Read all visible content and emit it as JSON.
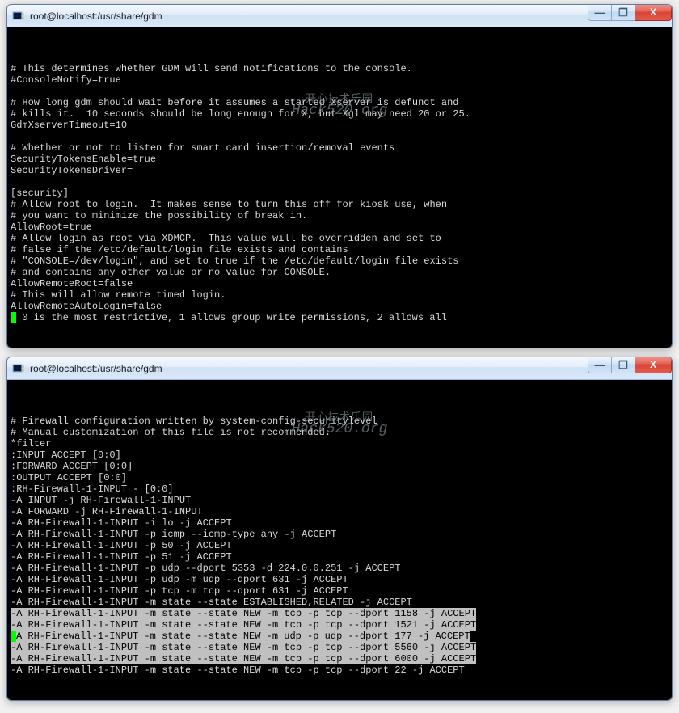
{
  "watermark": {
    "line1": "开心技术乐园",
    "line2": "Hack520.org"
  },
  "window1": {
    "title": "root@localhost:/usr/share/gdm",
    "controls": {
      "min": "—",
      "max": "❐",
      "close": "X"
    },
    "lines": [
      "# This determines whether GDM will send notifications to the console.",
      "#ConsoleNotify=true",
      "",
      "# How long gdm should wait before it assumes a started Xserver is defunct and",
      "# kills it.  10 seconds should be long enough for X, but Xgl may need 20 or 25.",
      "GdmXserverTimeout=10",
      "",
      "# Whether or not to listen for smart card insertion/removal events",
      "SecurityTokensEnable=true",
      "SecurityTokensDriver=",
      "",
      "[security]",
      "# Allow root to login.  It makes sense to turn this off for kiosk use, when",
      "# you want to minimize the possibility of break in.",
      "AllowRoot=true",
      "# Allow login as root via XDMCP.  This value will be overridden and set to",
      "# false if the /etc/default/login file exists and contains",
      "# \"CONSOLE=/dev/login\", and set to true if the /etc/default/login file exists",
      "# and contains any other value or no value for CONSOLE.",
      "AllowRemoteRoot=false",
      "# This will allow remote timed login.",
      "AllowRemoteAutoLogin=false",
      " 0 is the most restrictive, 1 allows group write permissions, 2 allows all"
    ],
    "prefix_last": "#"
  },
  "window2": {
    "title": "root@localhost:/usr/share/gdm",
    "controls": {
      "min": "—",
      "max": "❐",
      "close": "X"
    },
    "lines": [
      "# Firewall configuration written by system-config-securitylevel",
      "# Manual customization of this file is not recommended.",
      "*filter",
      ":INPUT ACCEPT [0:0]",
      ":FORWARD ACCEPT [0:0]",
      ":OUTPUT ACCEPT [0:0]",
      ":RH-Firewall-1-INPUT - [0:0]",
      "-A INPUT -j RH-Firewall-1-INPUT",
      "-A FORWARD -j RH-Firewall-1-INPUT",
      "-A RH-Firewall-1-INPUT -i lo -j ACCEPT",
      "-A RH-Firewall-1-INPUT -p icmp --icmp-type any -j ACCEPT",
      "-A RH-Firewall-1-INPUT -p 50 -j ACCEPT",
      "-A RH-Firewall-1-INPUT -p 51 -j ACCEPT",
      "-A RH-Firewall-1-INPUT -p udp --dport 5353 -d 224.0.0.251 -j ACCEPT",
      "-A RH-Firewall-1-INPUT -p udp -m udp --dport 631 -j ACCEPT",
      "-A RH-Firewall-1-INPUT -p tcp -m tcp --dport 631 -j ACCEPT",
      "-A RH-Firewall-1-INPUT -m state --state ESTABLISHED,RELATED -j ACCEPT"
    ],
    "hl_lines": [
      "-A RH-Firewall-1-INPUT -m state --state NEW -m tcp -p tcp --dport 1158 -j ACCEPT",
      "-A RH-Firewall-1-INPUT -m state --state NEW -m tcp -p tcp --dport 1521 -j ACCEPT",
      "A RH-Firewall-1-INPUT -m state --state NEW -m udp -p udp --dport 177 -j ACCEPT",
      "-A RH-Firewall-1-INPUT -m state --state NEW -m tcp -p tcp --dport 5560 -j ACCEPT",
      "-A RH-Firewall-1-INPUT -m state --state NEW -m tcp -p tcp --dport 6000 -j ACCEPT"
    ],
    "hl_prefix": "-",
    "trailing": "-A RH-Firewall-1-INPUT -m state --state NEW -m tcp -p tcp --dport 22 -j ACCEPT"
  }
}
